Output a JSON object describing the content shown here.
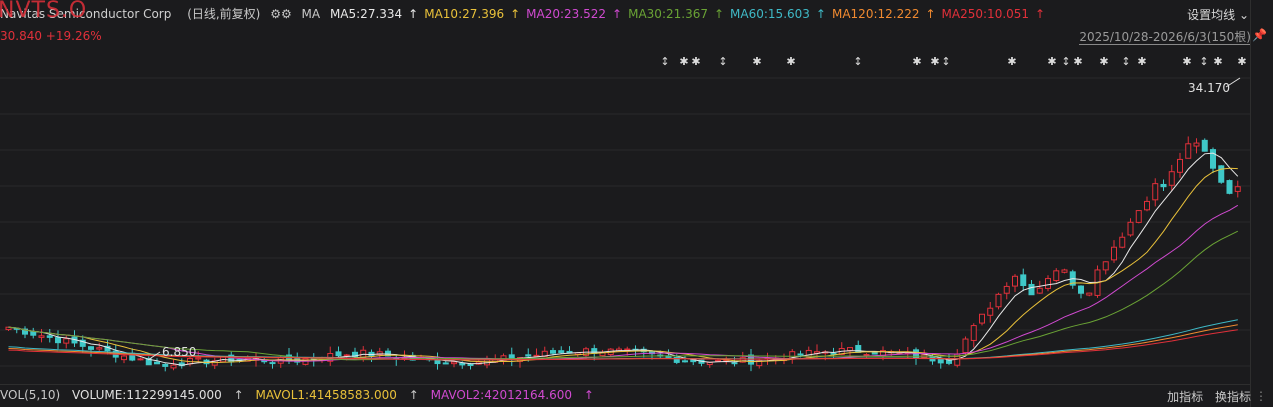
{
  "header": {
    "title": "Navitas Semiconductor Corp",
    "ticker_overlay": "NVTS.O",
    "mode": "(日线,前复权)",
    "settings_icon": "gear-icon",
    "ma_label": "MA",
    "ma_values": [
      {
        "label": "MA5:27.334",
        "color": "#e8e8e8"
      },
      {
        "label": "MA10:27.396",
        "color": "#e9c13a"
      },
      {
        "label": "MA20:23.522",
        "color": "#d04ad0"
      },
      {
        "label": "MA30:21.367",
        "color": "#6aa335"
      },
      {
        "label": "MA60:15.603",
        "color": "#3fb9c6"
      },
      {
        "label": "MA120:12.222",
        "color": "#f08a30"
      },
      {
        "label": "MA250:10.051",
        "color": "#e0303a"
      }
    ],
    "arrow_glyph": "↑",
    "settings_button": "设置均线",
    "price_line": "30.840 +19.26%",
    "date_range": "2025/10/28-2026/6/3",
    "bar_count": "(150根)",
    "pin_icon": "pin-icon"
  },
  "chart_data": {
    "type": "candlestick",
    "y_range": [
      6.0,
      38.0
    ],
    "high_marker": "34.170",
    "low_marker": "6.850",
    "colors": {
      "up": "#e0303a",
      "down": "#3fc8c8",
      "bg": "#1b1b1d",
      "grid": "#2a2a2a"
    },
    "ma_colors": [
      "#e8e8e8",
      "#e9c13a",
      "#d04ad0",
      "#6aa335",
      "#3fb9c6",
      "#f08a30",
      "#e0303a"
    ],
    "marker_glyphs": [
      "↕",
      "✱"
    ]
  },
  "footer": {
    "vol_label": "VOL(5,10)",
    "volume": "VOLUME:112299145.000",
    "mavol1": "MAVOL1:41458583.000",
    "mavol2": "MAVOL2:42012164.600",
    "mavol1_color": "#e9c13a",
    "mavol2_color": "#d04ad0",
    "add_indicator": "加指标",
    "switch_indicator": "换指标",
    "scroll_glyph": "⋮"
  }
}
